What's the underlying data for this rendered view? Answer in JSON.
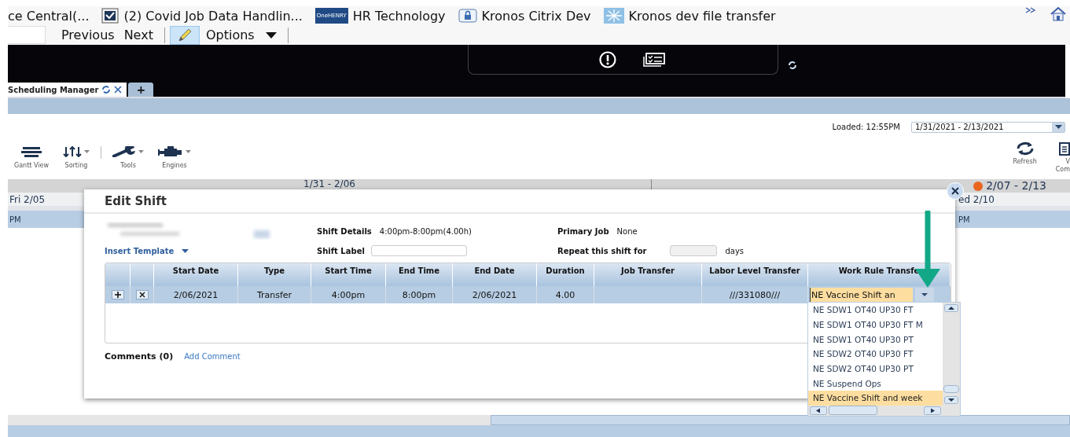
{
  "bookmarks": [
    {
      "label": "ce Central(...",
      "kind": "none"
    },
    {
      "label": "(2) Covid Job Data Handlin...",
      "kind": "mail"
    },
    {
      "label": "HR Technology",
      "kind": "logo",
      "logo_text": "OneHENRY"
    },
    {
      "label": "Kronos Citrix Dev",
      "kind": "lock"
    },
    {
      "label": "Kronos dev file transfer",
      "kind": "sparkle"
    }
  ],
  "nav": {
    "buttons": [
      "Previous",
      "Next"
    ],
    "edit_selected": true,
    "options": "Options"
  },
  "tabs": [
    {
      "label": "Scheduling Manager",
      "selected": true,
      "kind": "page"
    },
    {
      "label": "+",
      "selected": false,
      "kind": "add"
    }
  ],
  "loaded": "Loaded: 12:55PM",
  "date_range": "1/31/2021 - 2/13/2021",
  "tools": [
    {
      "label": "Gantt View",
      "kind": "gantt",
      "menu": false
    },
    {
      "label": "Sorting",
      "kind": "sort",
      "menu": true
    },
    {
      "label": "Tools",
      "kind": "wrench",
      "menu": true
    },
    {
      "label": "Engines",
      "kind": "engine",
      "menu": true
    }
  ],
  "right_tools": [
    {
      "lines": [
        "Refresh"
      ],
      "kind": "refresh"
    },
    {
      "lines": [
        "V",
        "Com"
      ],
      "kind": "clipboard"
    }
  ],
  "weeks": [
    {
      "label": "1/31 - 2/06",
      "alert": false
    },
    {
      "label": "2/07 - 2/13",
      "alert": true
    }
  ],
  "days": [
    "Fri 2/05",
    "ed 2/10"
  ],
  "time_cells": [
    "PM",
    "PM"
  ],
  "dialog": {
    "title": "Edit Shift",
    "shift_details_label": "Shift Details",
    "shift_details": "4:00pm-8:00pm(4.00h)",
    "primary_job_label": "Primary Job",
    "primary_job": "None",
    "insert_template": "Insert Template",
    "shift_label_label": "Shift Label",
    "repeat_label": "Repeat this shift for",
    "repeat_unit": "days",
    "columns": [
      {
        "label": "Start Date",
        "kind": "text"
      },
      {
        "label": "Type",
        "kind": "text"
      },
      {
        "label": "Start Time",
        "kind": "text"
      },
      {
        "label": "End Time",
        "kind": "text"
      },
      {
        "label": "End Date",
        "kind": "text"
      },
      {
        "label": "Duration",
        "kind": "text"
      },
      {
        "label": "Job Transfer",
        "kind": "text"
      },
      {
        "label": "Labor Level Transfer",
        "kind": "text"
      },
      {
        "label": "Work Rule Transfe",
        "kind": "dropdown"
      }
    ],
    "rows": [
      {
        "cells": [
          "2/06/2021",
          "Transfer",
          "4:00pm",
          "8:00pm",
          "2/06/2021",
          "4.00",
          null,
          "///331080///",
          "NE Vaccine Shift an"
        ]
      }
    ],
    "comments_label": "Comments (0)",
    "add_comment": "Add Comment"
  },
  "dropdown": {
    "options": [
      {
        "label": "NE SDW1 OT40 UP30 FT",
        "selected": false
      },
      {
        "label": "NE SDW1 OT40 UP30 FT M",
        "selected": false
      },
      {
        "label": "NE SDW1 OT40 UP30 PT",
        "selected": false
      },
      {
        "label": "NE SDW2 OT40 UP30 FT",
        "selected": false
      },
      {
        "label": "NE SDW2 OT40 UP30 PT",
        "selected": false
      },
      {
        "label": "NE Suspend Ops",
        "selected": false
      },
      {
        "label": "NE Vaccine Shift and week",
        "selected": true
      }
    ]
  }
}
